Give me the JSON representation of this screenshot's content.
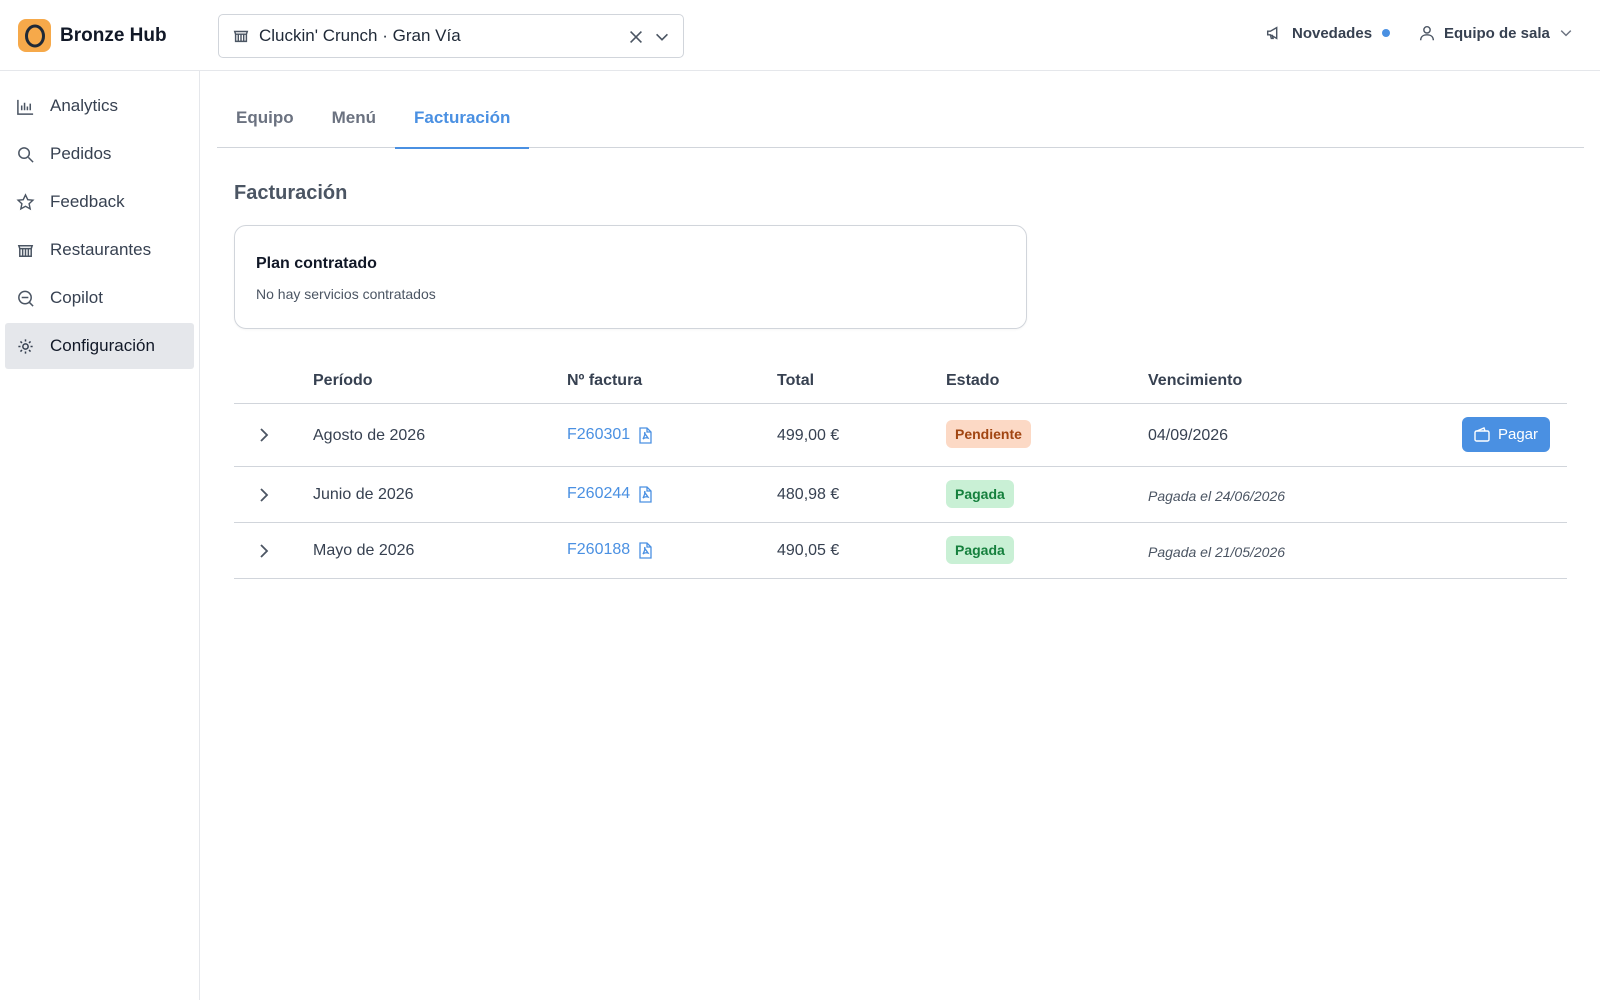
{
  "app": {
    "name": "Bronze Hub"
  },
  "restaurant_selector": {
    "value": "Cluckin' Crunch · Gran Vía"
  },
  "header": {
    "news_label": "Novedades",
    "user_label": "Equipo de sala"
  },
  "sidebar": {
    "items": [
      {
        "label": "Analytics",
        "icon": "bar-chart-icon"
      },
      {
        "label": "Pedidos",
        "icon": "search-icon"
      },
      {
        "label": "Feedback",
        "icon": "star-icon"
      },
      {
        "label": "Restaurantes",
        "icon": "store-icon"
      },
      {
        "label": "Copilot",
        "icon": "chat-icon"
      },
      {
        "label": "Configuración",
        "icon": "gear-icon",
        "active": true
      }
    ]
  },
  "tabs": [
    {
      "label": "Equipo"
    },
    {
      "label": "Menú"
    },
    {
      "label": "Facturación",
      "active": true
    }
  ],
  "billing": {
    "title": "Facturación",
    "plan": {
      "title": "Plan contratado",
      "description": "No hay servicios contratados"
    },
    "columns": {
      "period": "Período",
      "invoice": "Nº factura",
      "total": "Total",
      "status": "Estado",
      "due": "Vencimiento"
    },
    "rows": [
      {
        "period": "Agosto de 2026",
        "invoice": "F260301",
        "total": "499,00 €",
        "status": "Pendiente",
        "due": "04/09/2026",
        "action": "Pagar"
      },
      {
        "period": "Junio de 2026",
        "invoice": "F260244",
        "total": "480,98 €",
        "status": "Pagada",
        "due": "Pagada el 24/06/2026"
      },
      {
        "period": "Mayo de 2026",
        "invoice": "F260188",
        "total": "490,05 €",
        "status": "Pagada",
        "due": "Pagada el 21/05/2026"
      }
    ]
  },
  "colors": {
    "accent": "#4a90e2",
    "logo": "#f6a94a",
    "pending_bg": "#fcd9c5",
    "pending_text": "#a14511",
    "paid_bg": "#c9f0d5",
    "paid_text": "#15803d"
  }
}
